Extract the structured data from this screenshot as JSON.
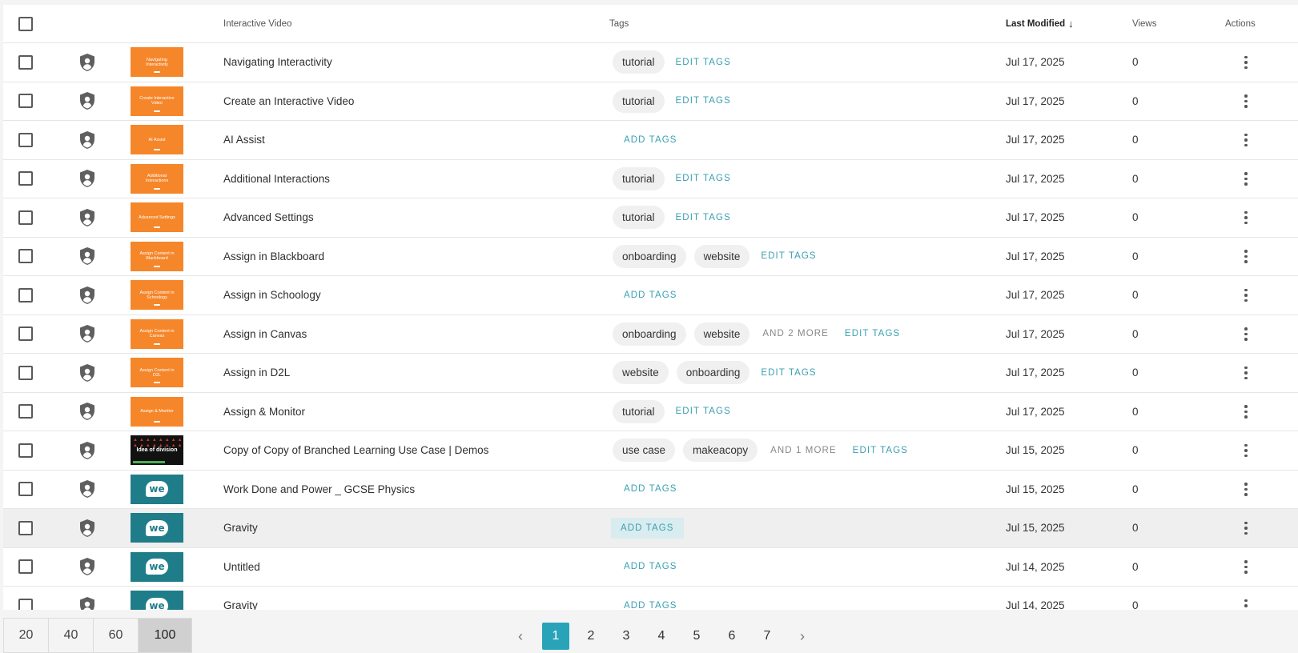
{
  "header": {
    "title_col": "Interactive Video",
    "tags_col": "Tags",
    "modified_col": "Last Modified",
    "sort_arrow": "↓",
    "views_col": "Views",
    "actions_col": "Actions"
  },
  "rows": [
    {
      "title": "Navigating Interactivity",
      "thumb": "orange",
      "thumb_text": "Navigating Interactivity",
      "tags": [
        "tutorial"
      ],
      "more": "",
      "link": "EDIT TAGS",
      "date": "Jul 17, 2025",
      "views": "0"
    },
    {
      "title": "Create an Interactive Video",
      "thumb": "orange",
      "thumb_text": "Create Interactive Video",
      "tags": [
        "tutorial"
      ],
      "more": "",
      "link": "EDIT TAGS",
      "date": "Jul 17, 2025",
      "views": "0"
    },
    {
      "title": "AI Assist",
      "thumb": "orange",
      "thumb_text": "AI Assist",
      "tags": [],
      "more": "",
      "link": "ADD TAGS",
      "date": "Jul 17, 2025",
      "views": "0"
    },
    {
      "title": "Additional Interactions",
      "thumb": "orange",
      "thumb_text": "Additional Interactions",
      "tags": [
        "tutorial"
      ],
      "more": "",
      "link": "EDIT TAGS",
      "date": "Jul 17, 2025",
      "views": "0"
    },
    {
      "title": "Advanced Settings",
      "thumb": "orange",
      "thumb_text": "Advanced Settings",
      "tags": [
        "tutorial"
      ],
      "more": "",
      "link": "EDIT TAGS",
      "date": "Jul 17, 2025",
      "views": "0"
    },
    {
      "title": "Assign in Blackboard",
      "thumb": "orange",
      "thumb_text": "Assign Content in Blackboard",
      "tags": [
        "onboarding",
        "website"
      ],
      "more": "",
      "link": "EDIT TAGS",
      "date": "Jul 17, 2025",
      "views": "0"
    },
    {
      "title": "Assign in Schoology",
      "thumb": "orange",
      "thumb_text": "Assign Content in Schoology",
      "tags": [],
      "more": "",
      "link": "ADD TAGS",
      "date": "Jul 17, 2025",
      "views": "0"
    },
    {
      "title": "Assign in Canvas",
      "thumb": "orange",
      "thumb_text": "Assign Content in Canvas",
      "tags": [
        "onboarding",
        "website"
      ],
      "more": "AND 2 MORE",
      "link": "EDIT TAGS",
      "date": "Jul 17, 2025",
      "views": "0"
    },
    {
      "title": "Assign in D2L",
      "thumb": "orange",
      "thumb_text": "Assign Content in D2L",
      "tags": [
        "website",
        "onboarding"
      ],
      "more": "",
      "link": "EDIT TAGS",
      "date": "Jul 17, 2025",
      "views": "0"
    },
    {
      "title": "Assign & Monitor",
      "thumb": "orange",
      "thumb_text": "Assign & Monitor",
      "tags": [
        "tutorial"
      ],
      "more": "",
      "link": "EDIT TAGS",
      "date": "Jul 17, 2025",
      "views": "0"
    },
    {
      "title": "Copy of Copy of Branched Learning Use Case | Demos",
      "thumb": "black",
      "thumb_text": "Idea of division",
      "tags": [
        "use case",
        "makeacopy"
      ],
      "more": "AND 1 MORE",
      "link": "EDIT TAGS",
      "date": "Jul 15, 2025",
      "views": "0"
    },
    {
      "title": "Work Done and Power _ GCSE Physics",
      "thumb": "teal",
      "thumb_text": "we",
      "tags": [],
      "more": "",
      "link": "ADD TAGS",
      "date": "Jul 15, 2025",
      "views": "0"
    },
    {
      "title": "Gravity",
      "thumb": "teal",
      "thumb_text": "we",
      "tags": [],
      "more": "",
      "link": "ADD TAGS",
      "date": "Jul 15, 2025",
      "views": "0",
      "highlight": true
    },
    {
      "title": "Untitled",
      "thumb": "teal",
      "thumb_text": "we",
      "tags": [],
      "more": "",
      "link": "ADD TAGS",
      "date": "Jul 14, 2025",
      "views": "0"
    },
    {
      "title": "Gravity",
      "thumb": "teal",
      "thumb_text": "we",
      "tags": [],
      "more": "",
      "link": "ADD TAGS",
      "date": "Jul 14, 2025",
      "views": "0"
    }
  ],
  "page_sizes": [
    {
      "label": "20",
      "active": false
    },
    {
      "label": "40",
      "active": false
    },
    {
      "label": "60",
      "active": false
    },
    {
      "label": "100",
      "active": true
    }
  ],
  "pagination": {
    "prev": "‹",
    "next": "›",
    "pages": [
      "1",
      "2",
      "3",
      "4",
      "5",
      "6",
      "7"
    ],
    "current": "1"
  }
}
